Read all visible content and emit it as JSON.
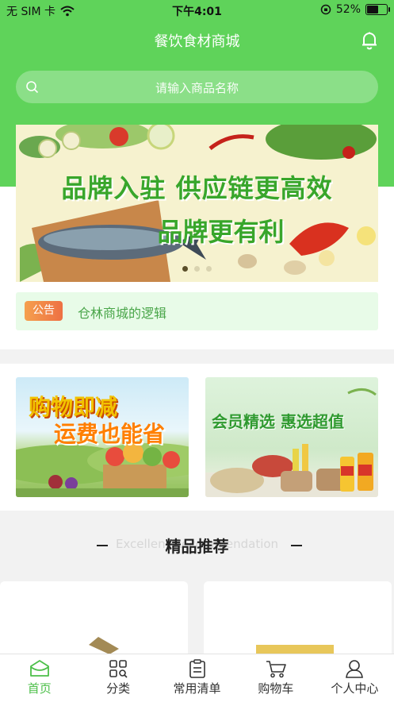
{
  "status_bar": {
    "carrier": "无 SIM 卡",
    "time": "下午4:01",
    "battery": "52%",
    "battery_level": 0.52
  },
  "header": {
    "title": "餐饮食材商城"
  },
  "search": {
    "placeholder": "请输入商品名称"
  },
  "banner": {
    "line1": "品牌入驻 供应链更高效",
    "line2": "品牌更有利",
    "slides": 3,
    "active_slide": 0
  },
  "notice": {
    "badge": "公告",
    "text": "仓林商城的逻辑"
  },
  "promos": [
    {
      "line1": "购物即减",
      "line2": "运费也能省"
    },
    {
      "line1": "会员精选 惠选超值"
    }
  ],
  "section": {
    "title": "精品推荐",
    "subtitle": "Excellent Recommendation"
  },
  "tabs": [
    {
      "label": "首页",
      "icon": "home-icon",
      "active": true
    },
    {
      "label": "分类",
      "icon": "category-icon",
      "active": false
    },
    {
      "label": "常用清单",
      "icon": "list-icon",
      "active": false
    },
    {
      "label": "购物车",
      "icon": "cart-icon",
      "active": false
    },
    {
      "label": "个人中心",
      "icon": "user-icon",
      "active": false
    }
  ],
  "colors": {
    "primary_green": "#5fd35a",
    "active_tab": "#4cbf49",
    "notice_bg": "#e8fbe8",
    "badge_orange": "#ee7043"
  }
}
